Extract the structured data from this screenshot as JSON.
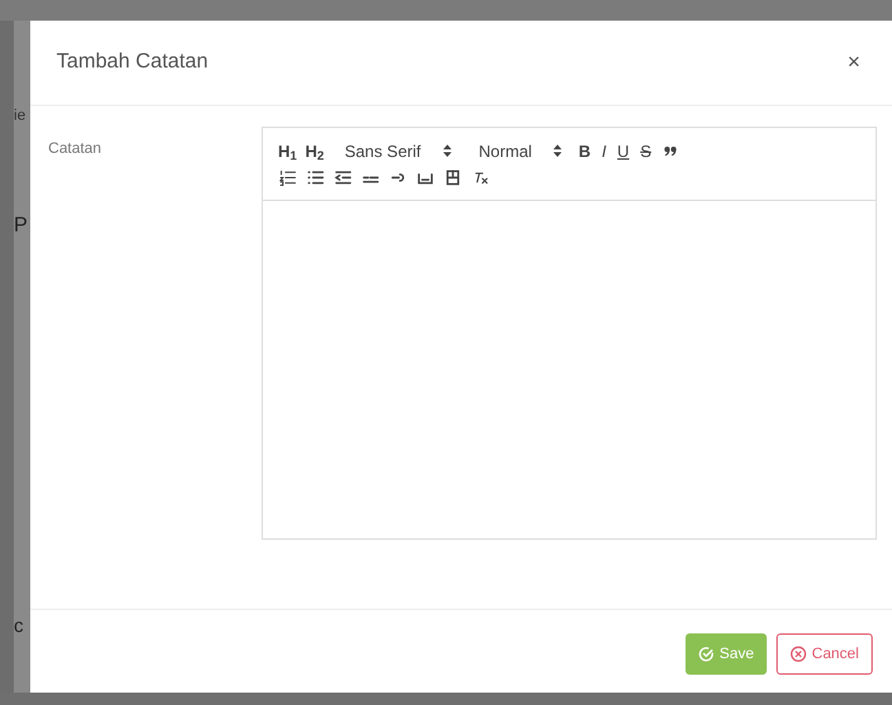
{
  "background": {
    "fragments": [
      "ie",
      "P",
      "c"
    ]
  },
  "modal": {
    "title": "Tambah Catatan",
    "close": "×"
  },
  "form": {
    "label": "Catatan",
    "toolbar": [
      [
        {
          "kind": "header",
          "label": "H$_{1}$"
        },
        {
          "kind": "header",
          "label": "H$_{2}$"
        },
        {
          "kind": "select",
          "value": "Sans Serif"
        },
        {
          "kind": "select",
          "value": "Normal"
        },
        {
          "kind": "bold",
          "label": "B"
        },
        {
          "kind": "italic",
          "label": "I"
        },
        {
          "kind": "underline",
          "label": "U"
        },
        {
          "kind": "strike",
          "label": "S"
        },
        {
          "kind": "blockquote"
        }
      ],
      [
        {
          "kind": "ordered_list"
        },
        {
          "kind": "bullet_list"
        },
        {
          "kind": "outdent"
        },
        {
          "kind": "indent"
        },
        {
          "kind": "link"
        },
        {
          "kind": "image"
        },
        {
          "kind": "video"
        },
        {
          "kind": "clean"
        }
      ]
    ]
  },
  "buttons": [
    {
      "kind": "save",
      "label": "Save"
    },
    {
      "kind": "cancel",
      "label": "Cancel"
    }
  ]
}
